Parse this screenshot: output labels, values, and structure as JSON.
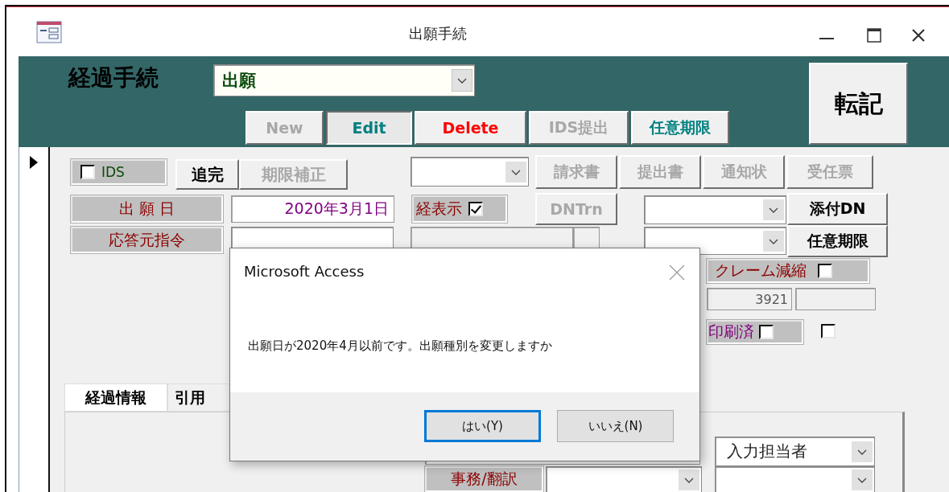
{
  "window": {
    "title": "出願手続"
  },
  "header": {
    "label": "経過手続",
    "combo_value": "出願",
    "buttons": [
      {
        "label": "New",
        "disabled": true,
        "pressed": false
      },
      {
        "label": "Edit",
        "disabled": false,
        "pressed": true,
        "color": "#008080"
      },
      {
        "label": "Delete",
        "disabled": false,
        "pressed": false,
        "color": "#ff0000"
      },
      {
        "label": "IDS提出",
        "disabled": true,
        "pressed": false
      },
      {
        "label": "任意期限",
        "disabled": false,
        "pressed": false,
        "color": "#008080"
      }
    ],
    "transfer_button": "転記"
  },
  "record_selector": {
    "current": true
  },
  "form": {
    "ids_checkbox": {
      "label": "IDS",
      "checked": false
    },
    "buttons": [
      {
        "label": "追完",
        "disabled": false
      },
      {
        "label": "期限補正",
        "disabled": true
      }
    ],
    "doc_buttons": [
      {
        "label": "請求書",
        "disabled": true
      },
      {
        "label": "提出書",
        "disabled": true
      },
      {
        "label": "通知状",
        "disabled": true
      },
      {
        "label": "受任票",
        "disabled": true
      }
    ],
    "dntrn_button": {
      "label": "DNTrn",
      "disabled": true
    },
    "side_buttons": [
      {
        "label": "添付DN",
        "disabled": false
      },
      {
        "label": "任意期限",
        "disabled": false
      }
    ],
    "filing_date": {
      "label": "出 願 日",
      "value": "2020年3月1日"
    },
    "response_source": {
      "label": "応答元指令"
    },
    "display_checkbox": {
      "label": "経表示",
      "checked": true
    },
    "claim_reduction": {
      "label": "クレーム減縮",
      "checked": false
    },
    "number_field": {
      "value": "3921"
    },
    "printed": {
      "label": "印刷済",
      "checked": false
    },
    "extra_checkbox": {
      "checked": false
    },
    "tabs": [
      {
        "label": "経過情報",
        "selected": true
      },
      {
        "label": "引用",
        "selected": false
      }
    ],
    "input_person": {
      "value": "入力担当者"
    },
    "office_translation": {
      "label": "事務/翻訳"
    }
  },
  "dialog": {
    "title": "Microsoft Access",
    "message": "出願日が2020年4月以前です。出願種別を変更しますか",
    "buttons": [
      {
        "label": "はい(Y)",
        "default": true
      },
      {
        "label": "いいえ(N)",
        "default": false
      }
    ]
  }
}
